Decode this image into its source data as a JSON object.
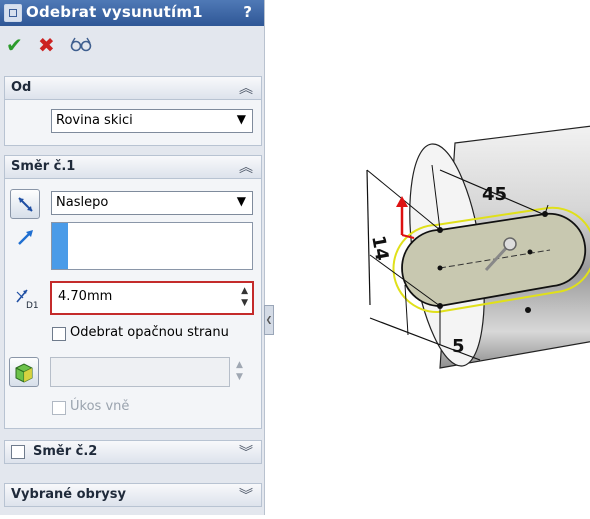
{
  "title": "Odebrat vysunutím1",
  "help": "?",
  "actions": {
    "ok_icon": "check-icon",
    "cancel_icon": "cross-icon",
    "preview_icon": "glasses-icon"
  },
  "od": {
    "label": "Od",
    "value": "Rovina skici"
  },
  "smer1": {
    "label": "Směr č.1",
    "end_condition": "Naslepo",
    "depth": "4.70mm",
    "depth_label": "D1",
    "flip_side_label": "Odebrat opačnou stranu",
    "draft_label": "Úkos vně"
  },
  "smer2": {
    "label": "Směr č.2"
  },
  "contours": {
    "label": "Vybrané obrysy"
  },
  "model": {
    "dim_45": "45",
    "dim_14": "14",
    "dim_5": "5"
  },
  "colors": {
    "title_bar": "#3a64a5",
    "highlight": "#c42b2b",
    "selection": "#e0e01a"
  }
}
